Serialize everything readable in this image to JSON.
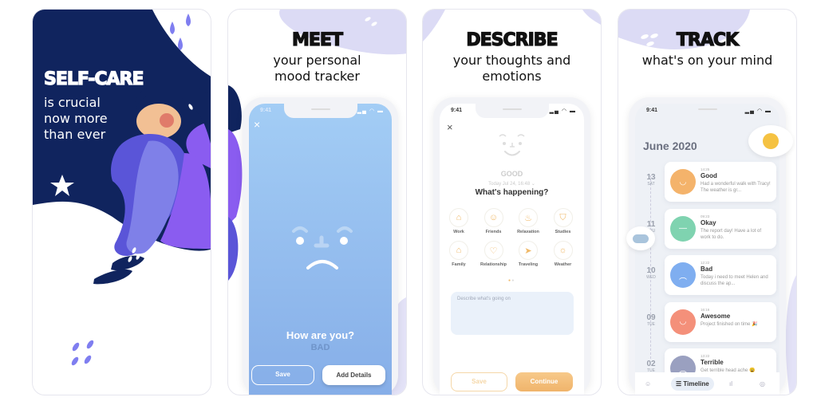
{
  "cards": [
    {
      "headline": "SELF-CARE",
      "subtitle_lines": [
        "is crucial",
        "now more",
        "than ever"
      ]
    },
    {
      "headline": "MEET",
      "subtitle_lines": [
        "your personal",
        "mood tracker"
      ],
      "phone": {
        "time": "9:41",
        "close_icon": "×",
        "question": "How are you?",
        "mood": "BAD",
        "save_label": "Save",
        "add_details_label": "Add Details"
      }
    },
    {
      "headline": "DESCRIBE",
      "subtitle_lines": [
        "your thoughts and",
        "emotions"
      ],
      "phone": {
        "time": "9:41",
        "close_icon": "×",
        "mood": "GOOD",
        "date": "Today Jul 24, 16:48 ⌄",
        "question": "What's happening?",
        "categories": [
          {
            "label": "Work",
            "icon": "briefcase-icon",
            "glyph": "⌂"
          },
          {
            "label": "Friends",
            "icon": "friends-icon",
            "glyph": "☺"
          },
          {
            "label": "Relaxation",
            "icon": "meditation-icon",
            "glyph": "♨"
          },
          {
            "label": "Studies",
            "icon": "graduation-cap-icon",
            "glyph": "⛉"
          },
          {
            "label": "Family",
            "icon": "home-icon",
            "glyph": "⌂"
          },
          {
            "label": "Relationship",
            "icon": "heart-icon",
            "glyph": "♡"
          },
          {
            "label": "Traveling",
            "icon": "paper-plane-icon",
            "glyph": "➤"
          },
          {
            "label": "Weather",
            "icon": "sun-icon",
            "glyph": "☼"
          }
        ],
        "note_placeholder": "Describe what's going on",
        "save_label": "Save",
        "continue_label": "Continue"
      }
    },
    {
      "headline": "TRACK",
      "subtitle_lines": [
        "what's on your mind"
      ],
      "phone": {
        "time": "9:41",
        "month": "June 2020",
        "entries": [
          {
            "day": "13",
            "weekday": "SAT",
            "time": "14:25",
            "mood": "Good",
            "note": "Had a wonderful walk with Tracy! The weather is gr...",
            "color": "#f4b36b",
            "face": "◡"
          },
          {
            "day": "11",
            "weekday": "THU",
            "time": "09:23",
            "mood": "Okay",
            "note": "The report day! Have a lot of work to do.",
            "color": "#7fd3b0",
            "face": "—"
          },
          {
            "day": "10",
            "weekday": "WED",
            "time": "12:22",
            "mood": "Bad",
            "note": "Today i need to meet Helen and discuss the ap...",
            "color": "#7faef0",
            "face": "︵"
          },
          {
            "day": "09",
            "weekday": "TUE",
            "time": "16:16",
            "mood": "Awesome",
            "note": "Project finished on time 🎉",
            "color": "#f4907a",
            "face": "◡"
          },
          {
            "day": "02",
            "weekday": "TUE",
            "time": "13:22",
            "mood": "Terrible",
            "note": "Get terrible head ache 😩",
            "color": "#9aa0c0",
            "face": "︵"
          }
        ],
        "tabs": [
          {
            "icon": "smiley-icon",
            "glyph": "☺",
            "label": ""
          },
          {
            "icon": "list-icon",
            "glyph": "☰",
            "label": "Timeline"
          },
          {
            "icon": "bar-chart-icon",
            "glyph": "ıl",
            "label": ""
          },
          {
            "icon": "settings-icon",
            "glyph": "◎",
            "label": ""
          }
        ]
      }
    }
  ]
}
